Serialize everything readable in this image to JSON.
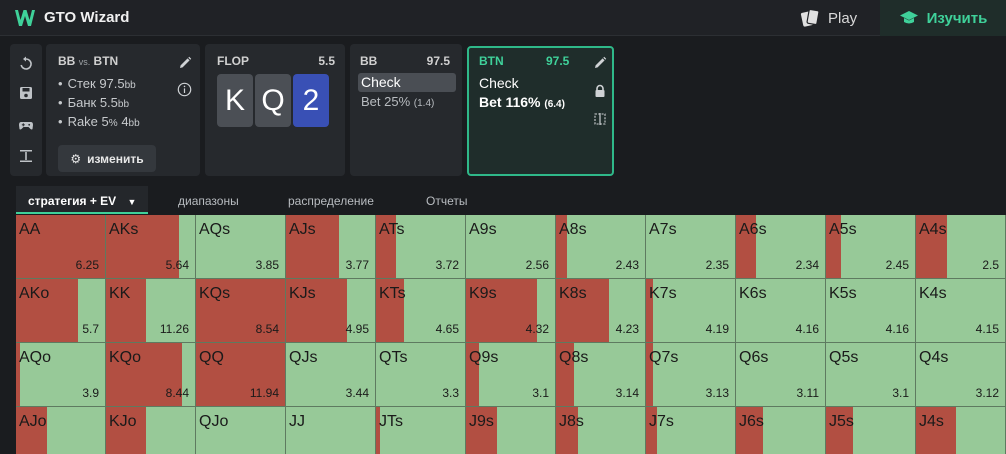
{
  "topbar": {
    "brand": "GTO Wizard",
    "play_label": "Play",
    "learn_label": "Изучить",
    "accent_color": "#3fd19a"
  },
  "tools": [
    "undo-icon",
    "save-icon",
    "gamepad-icon",
    "align-icon"
  ],
  "info": {
    "title_a": "BB",
    "title_vs": "vs.",
    "title_b": "BTN",
    "stack_label": "Стек",
    "stack_value": "97.5",
    "stack_unit": "bb",
    "pot_label": "Банк",
    "pot_value": "5.5",
    "pot_unit": "bb",
    "rake_label": "Rake",
    "rake_pct": "5",
    "rake_pct_unit": "%",
    "rake_cap": "4",
    "rake_cap_unit": "bb",
    "edit_label": "изменить"
  },
  "flop": {
    "label": "FLOP",
    "pot": "5.5",
    "cards": [
      {
        "rank": "K",
        "color": "#4b4f55"
      },
      {
        "rank": "Q",
        "color": "#4b4f55"
      },
      {
        "rank": "2",
        "color": "#3950b5"
      }
    ]
  },
  "bb_node": {
    "player": "BB",
    "stack": "97.5",
    "check": "Check",
    "bet": "Bet 25%",
    "bet_size": "(1.4)"
  },
  "btn_node": {
    "player": "BTN",
    "stack": "97.5",
    "check": "Check",
    "bet": "Bet 116%",
    "bet_size": "(6.4)"
  },
  "tabs": [
    "стратегия + EV",
    "диапазоны",
    "распределение",
    "Отчеты"
  ],
  "colors": {
    "bet": "#b24f42",
    "check": "#97c998"
  },
  "grid": [
    [
      {
        "hand": "AA",
        "ev": "6.25",
        "bet": 1.0
      },
      {
        "hand": "AKs",
        "ev": "5.64",
        "bet": 0.82
      },
      {
        "hand": "AQs",
        "ev": "3.85",
        "bet": 0.0
      },
      {
        "hand": "AJs",
        "ev": "3.77",
        "bet": 0.6
      },
      {
        "hand": "ATs",
        "ev": "3.72",
        "bet": 0.22
      },
      {
        "hand": "A9s",
        "ev": "2.56",
        "bet": 0.0
      },
      {
        "hand": "A8s",
        "ev": "2.43",
        "bet": 0.12
      },
      {
        "hand": "A7s",
        "ev": "2.35",
        "bet": 0.0
      },
      {
        "hand": "A6s",
        "ev": "2.34",
        "bet": 0.22
      },
      {
        "hand": "A5s",
        "ev": "2.45",
        "bet": 0.17
      },
      {
        "hand": "A4s",
        "ev": "2.5",
        "bet": 0.35
      }
    ],
    [
      {
        "hand": "AKo",
        "ev": "5.7",
        "bet": 0.7
      },
      {
        "hand": "KK",
        "ev": "11.26",
        "bet": 0.45
      },
      {
        "hand": "KQs",
        "ev": "8.54",
        "bet": 1.0
      },
      {
        "hand": "KJs",
        "ev": "4.95",
        "bet": 0.68
      },
      {
        "hand": "KTs",
        "ev": "4.65",
        "bet": 0.32
      },
      {
        "hand": "K9s",
        "ev": "4.32",
        "bet": 0.8
      },
      {
        "hand": "K8s",
        "ev": "4.23",
        "bet": 0.6
      },
      {
        "hand": "K7s",
        "ev": "4.19",
        "bet": 0.08
      },
      {
        "hand": "K6s",
        "ev": "4.16",
        "bet": 0.0
      },
      {
        "hand": "K5s",
        "ev": "4.16",
        "bet": 0.0
      },
      {
        "hand": "K4s",
        "ev": "4.15",
        "bet": 0.0
      }
    ],
    [
      {
        "hand": "AQo",
        "ev": "3.9",
        "bet": 0.05
      },
      {
        "hand": "KQo",
        "ev": "8.44",
        "bet": 0.85
      },
      {
        "hand": "QQ",
        "ev": "11.94",
        "bet": 1.0
      },
      {
        "hand": "QJs",
        "ev": "3.44",
        "bet": 0.0
      },
      {
        "hand": "QTs",
        "ev": "3.3",
        "bet": 0.0
      },
      {
        "hand": "Q9s",
        "ev": "3.1",
        "bet": 0.15
      },
      {
        "hand": "Q8s",
        "ev": "3.14",
        "bet": 0.2
      },
      {
        "hand": "Q7s",
        "ev": "3.13",
        "bet": 0.08
      },
      {
        "hand": "Q6s",
        "ev": "3.11",
        "bet": 0.0
      },
      {
        "hand": "Q5s",
        "ev": "3.1",
        "bet": 0.0
      },
      {
        "hand": "Q4s",
        "ev": "3.12",
        "bet": 0.0
      }
    ],
    [
      {
        "hand": "AJo",
        "ev": "",
        "bet": 0.35
      },
      {
        "hand": "KJo",
        "ev": "",
        "bet": 0.45
      },
      {
        "hand": "QJo",
        "ev": "",
        "bet": 0.0
      },
      {
        "hand": "JJ",
        "ev": "",
        "bet": 0.0
      },
      {
        "hand": "JTs",
        "ev": "",
        "bet": 0.05
      },
      {
        "hand": "J9s",
        "ev": "",
        "bet": 0.35
      },
      {
        "hand": "J8s",
        "ev": "",
        "bet": 0.25
      },
      {
        "hand": "J7s",
        "ev": "",
        "bet": 0.12
      },
      {
        "hand": "J6s",
        "ev": "",
        "bet": 0.3
      },
      {
        "hand": "J5s",
        "ev": "",
        "bet": 0.3
      },
      {
        "hand": "J4s",
        "ev": "",
        "bet": 0.45
      }
    ]
  ]
}
